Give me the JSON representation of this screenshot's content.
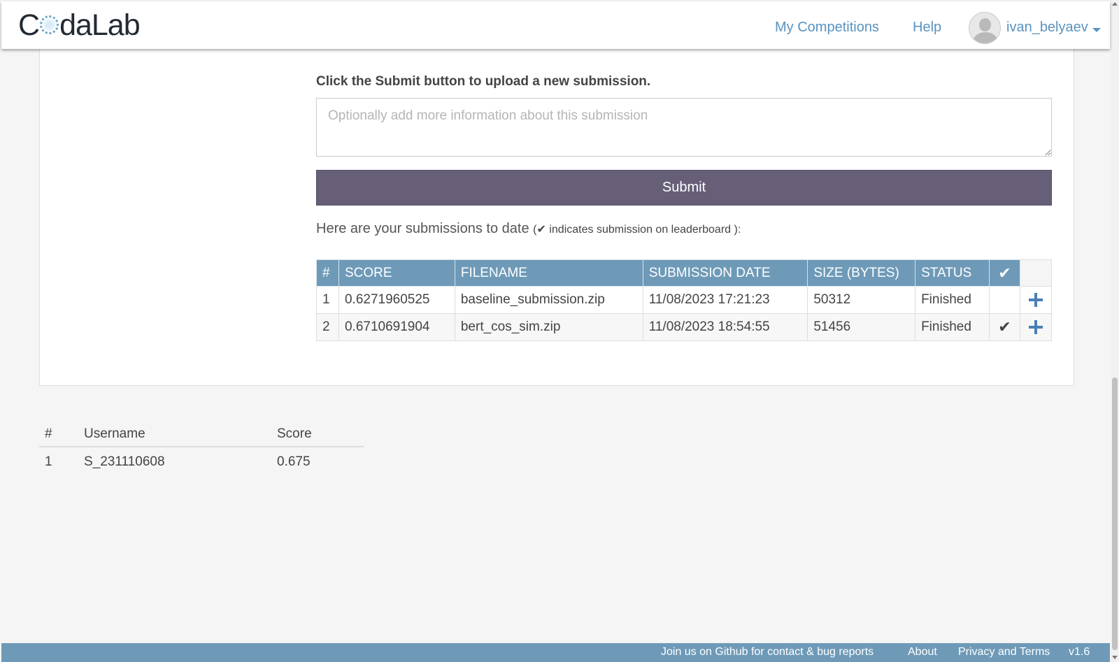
{
  "navbar": {
    "logo_prefix": "C",
    "logo_suffix": "daLab",
    "my_competitions": "My Competitions",
    "help": "Help",
    "username": "ivan_belyaev"
  },
  "submission_form": {
    "instruction": "Click the Submit button to upload a new submission.",
    "description_placeholder": "Optionally add more information about this submission",
    "description_value": "",
    "submit_label": "Submit"
  },
  "submissions": {
    "intro": "Here are your submissions to date",
    "note": "indicates submission on leaderboard",
    "columns": [
      "#",
      "SCORE",
      "FILENAME",
      "SUBMISSION DATE",
      "SIZE (BYTES)",
      "STATUS"
    ],
    "rows": [
      {
        "num": "1",
        "score": "0.6271960525",
        "filename": "baseline_submission.zip",
        "date": "11/08/2023 17:21:23",
        "size": "50312",
        "status": "Finished",
        "on_leaderboard": false
      },
      {
        "num": "2",
        "score": "0.6710691904",
        "filename": "bert_cos_sim.zip",
        "date": "11/08/2023 18:54:55",
        "size": "51456",
        "status": "Finished",
        "on_leaderboard": true
      }
    ]
  },
  "leaderboard": {
    "columns": [
      "#",
      "Username",
      "Score"
    ],
    "rows": [
      {
        "rank": "1",
        "username": "S_231110608",
        "score": "0.675"
      }
    ]
  },
  "footer": {
    "github": "Join us on Github for contact & bug reports",
    "about": "About",
    "privacy": "Privacy and Terms",
    "version": "v1.6"
  },
  "colors": {
    "accent": "#6e9ab8",
    "submit_button": "#675f78",
    "link": "#5a93bf",
    "check": "#2e7d32"
  }
}
